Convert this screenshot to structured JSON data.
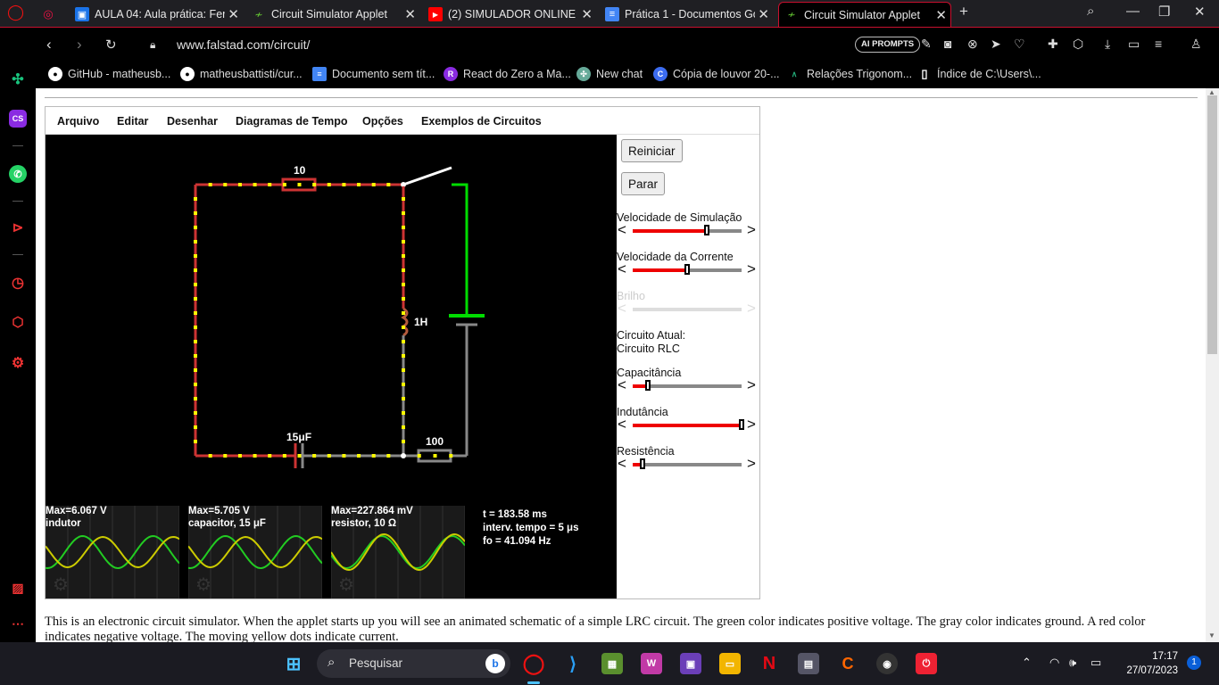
{
  "browser": {
    "tabs": [
      {
        "title": "",
        "icon": "gamepad-icon"
      },
      {
        "title": "AULA 04: Aula prática: Ferr",
        "icon": "classroom-icon"
      },
      {
        "title": "Circuit Simulator Applet",
        "icon": "falstad-icon"
      },
      {
        "title": "(2) SIMULADOR ONLINE E",
        "icon": "youtube-icon"
      },
      {
        "title": "Prática 1 - Documentos Go",
        "icon": "docs-icon"
      },
      {
        "title": "Circuit Simulator Applet",
        "icon": "falstad-icon",
        "active": true
      }
    ],
    "new_tab": "+",
    "url": "www.falstad.com/circuit/",
    "ai_prompts": "AI PROMPTS",
    "bookmarks": [
      {
        "label": "GitHub - matheusb...",
        "icon": "github-icon"
      },
      {
        "label": "matheusbattisti/cur...",
        "icon": "github-icon"
      },
      {
        "label": "Documento sem tít...",
        "icon": "docs-icon"
      },
      {
        "label": "React do Zero a Ma...",
        "icon": "react-course-icon"
      },
      {
        "label": "New chat",
        "icon": "chatgpt-icon"
      },
      {
        "label": "Cópia de louvor 20-...",
        "icon": "canva-icon"
      },
      {
        "label": "Relações Trigonom...",
        "icon": "math-icon"
      },
      {
        "label": "Índice de C:\\Users\\...",
        "icon": "file-icon"
      }
    ],
    "accent_color": "#c8102e"
  },
  "applet": {
    "menu": [
      "Arquivo",
      "Editar",
      "Desenhar",
      "Diagramas de Tempo",
      "Opções",
      "Exemplos de Circuitos"
    ],
    "components": {
      "resistor_top": "10",
      "inductor": "1H",
      "capacitor": "15μF",
      "resistor_bottom": "100"
    },
    "scopes": [
      {
        "max": "Max=6.067 V",
        "name": "indutor"
      },
      {
        "max": "Max=5.705 V",
        "name": "capacitor, 15 μF"
      },
      {
        "max": "Max=227.864 mV",
        "name": "resistor, 10 Ω"
      }
    ],
    "info": {
      "time": "t = 183.58 ms",
      "timestep": "interv. tempo = 5 μs",
      "freq": "fo = 41.094 Hz"
    },
    "controls": {
      "reset": "Reiniciar",
      "stop": "Parar",
      "sim_speed": {
        "label": "Velocidade de Simulação",
        "value": 0.68
      },
      "current_speed": {
        "label": "Velocidade da Corrente",
        "value": 0.5
      },
      "brightness": {
        "label": "Brilho",
        "value": 0.5,
        "disabled": true
      },
      "current_circuit_label": "Circuito Atual:",
      "current_circuit": "Circuito RLC",
      "capacitance": {
        "label": "Capacitância",
        "value": 0.14
      },
      "inductance": {
        "label": "Indutância",
        "value": 1.0
      },
      "resistance": {
        "label": "Resistência",
        "value": 0.09
      }
    },
    "colors": {
      "negative": "#cc3333",
      "positive": "#00ee00",
      "ground": "#888888",
      "current_dots": "#ffff00"
    }
  },
  "description": "This is an electronic circuit simulator.  When the applet starts up you will see an animated schematic of a simple LRC circuit. The green color indicates positive voltage.  The gray color indicates ground.  A red color indicates negative voltage.  The moving yellow dots indicate current.",
  "taskbar": {
    "search": "Pesquisar",
    "apps": [
      "windows-start-icon",
      "opera-icon",
      "vscode-icon",
      "minecraft-icon",
      "app-w-icon",
      "app-chip-icon",
      "explorer-icon",
      "netflix-icon",
      "calculator-icon",
      "app-c-icon",
      "obs-icon",
      "app-power-icon"
    ],
    "time": "17:17",
    "date": "27/07/2023",
    "notifications": "1"
  }
}
